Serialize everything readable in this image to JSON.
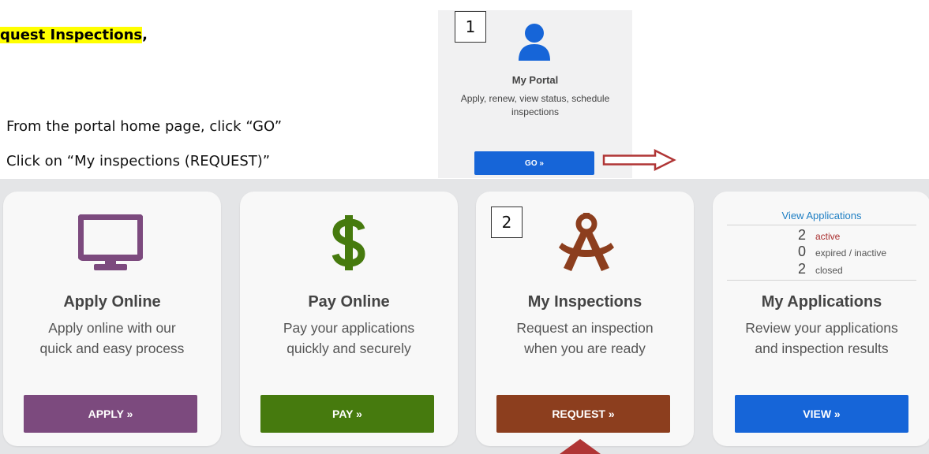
{
  "instructions": {
    "heading": "quest Inspections",
    "heading_suffix": ",",
    "step1": "From the portal home page, click “GO”",
    "step2": "Click on “My inspections (REQUEST)”"
  },
  "badges": {
    "one": "1",
    "two": "2"
  },
  "portal_card": {
    "icon": "person-icon",
    "title": "My Portal",
    "description_line1": "Apply, renew, view status, schedule",
    "description_line2": "inspections",
    "button_label": "GO »",
    "button_color": "#1665d8"
  },
  "tiles": [
    {
      "icon": "monitor-icon",
      "title": "Apply Online",
      "desc_line1": "Apply online with our",
      "desc_line2": "quick and easy process",
      "button_label": "APPLY »",
      "color": "#7c4a7e"
    },
    {
      "icon": "dollar-icon",
      "title": "Pay Online",
      "desc_line1": "Pay your applications",
      "desc_line2": "quickly and securely",
      "button_label": "PAY »",
      "color": "#467a0e"
    },
    {
      "icon": "compass-icon",
      "title": "My Inspections",
      "desc_line1": "Request an inspection",
      "desc_line2": "when you are ready",
      "button_label": "REQUEST »",
      "color": "#8c3e1e"
    },
    {
      "title": "My Applications",
      "desc_line1": "Review your applications",
      "desc_line2": "and inspection results",
      "button_label": "VIEW »",
      "color": "#1665d8",
      "link": "View Applications",
      "counts": [
        {
          "num": "2",
          "label": "active"
        },
        {
          "num": "0",
          "label": "expired / inactive"
        },
        {
          "num": "2",
          "label": "closed"
        }
      ]
    }
  ],
  "annotation_color": "#b03535"
}
